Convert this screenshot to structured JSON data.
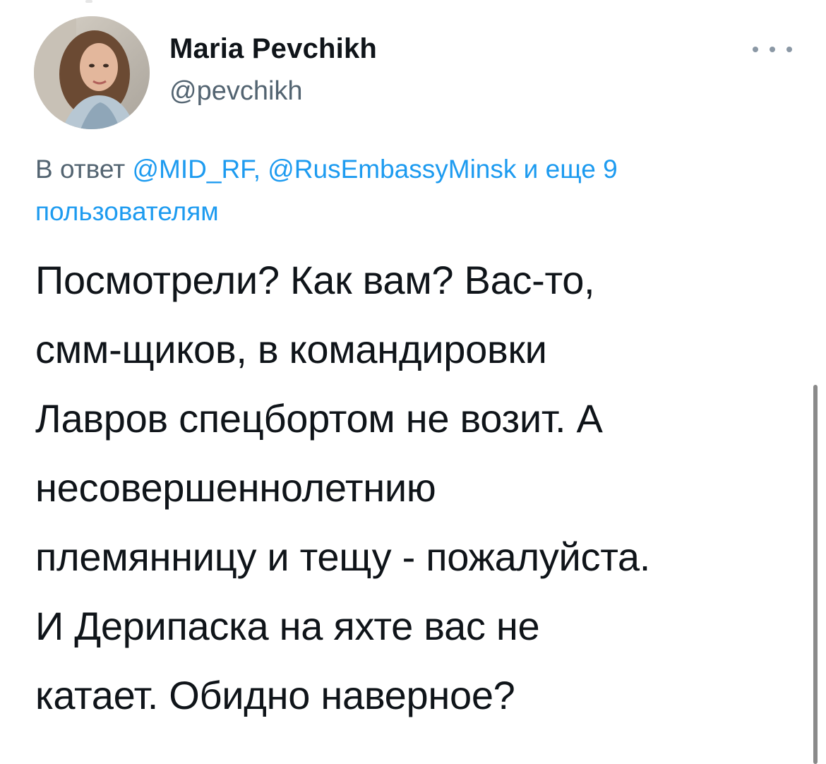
{
  "author": {
    "display_name": "Maria Pevchikh",
    "handle": "@pevchikh",
    "avatar_icon": "user-avatar-photo"
  },
  "more_icon": "ellipsis-icon",
  "reply_context": {
    "prefix": "В ответ ",
    "mention_1": "@MID_RF",
    "separator": ", ",
    "mention_2": "@RusEmbassyMinsk",
    "others": " и еще 9 пользователям"
  },
  "tweet_text": {
    "lines": [
      "Посмотрели? Как вам? Вас-то,",
      "смм-щиков, в командировки",
      "Лавров спецбортом не возит. А",
      "несовершеннолетнию",
      "племянницу и тещу - пожалуйста.",
      "И Дерипаска на яхте вас не",
      "катает. Обидно наверное?"
    ]
  },
  "colors": {
    "link": "#1d9bf0",
    "secondary_text": "#536471",
    "primary_text": "#0f1419"
  }
}
